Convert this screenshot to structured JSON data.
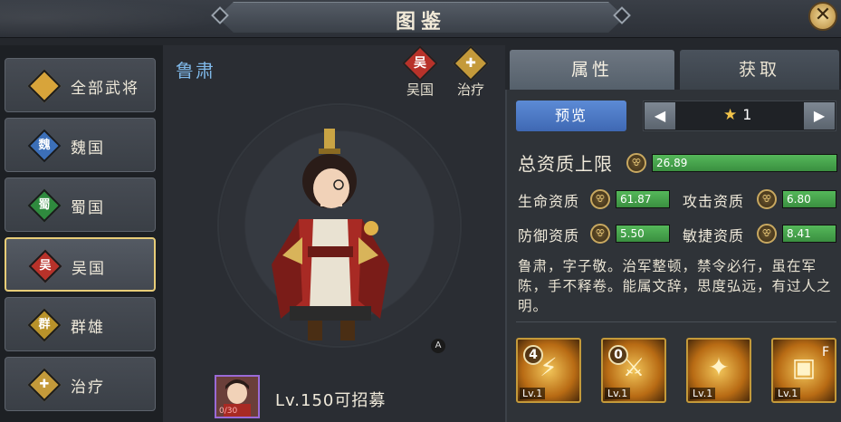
{
  "header": {
    "title": "图鉴",
    "close_symbol": "✕"
  },
  "sidebar": {
    "items": [
      {
        "label": "全部武将",
        "icon": "all-generals-icon",
        "glyph": "",
        "color": "#d8a43a",
        "active": false
      },
      {
        "label": "魏国",
        "icon": "wei-icon",
        "glyph": "魏",
        "color": "#3c6fb8",
        "active": false
      },
      {
        "label": "蜀国",
        "icon": "shu-icon",
        "glyph": "蜀",
        "color": "#2f8a3e",
        "active": false
      },
      {
        "label": "吴国",
        "icon": "wu-icon",
        "glyph": "吴",
        "color": "#b8322a",
        "active": true
      },
      {
        "label": "群雄",
        "icon": "qunxiong-icon",
        "glyph": "群",
        "color": "#b8922a",
        "active": false
      },
      {
        "label": "治疗",
        "icon": "heal-icon",
        "glyph": "✚",
        "color": "#c49a3a",
        "active": false
      }
    ]
  },
  "hero": {
    "name": "鲁肃",
    "faction": {
      "label": "吴国",
      "glyph": "吴"
    },
    "role": {
      "label": "治疗",
      "glyph": "✚"
    },
    "portrait_count": "0/30",
    "recruit_text": "Lv.150可招募",
    "badge": "A"
  },
  "tabs": {
    "attributes": "属性",
    "obtain": "获取"
  },
  "panel": {
    "preview_label": "预览",
    "star_value": "1",
    "total": {
      "label": "总资质上限",
      "value": "26.89",
      "fill": 1.0
    },
    "stats": [
      {
        "label": "生命资质",
        "value": "61.87",
        "fill": 1.0
      },
      {
        "label": "攻击资质",
        "value": "6.80",
        "fill": 1.0
      },
      {
        "label": "防御资质",
        "value": "5.50",
        "fill": 1.0
      },
      {
        "label": "敏捷资质",
        "value": "8.41",
        "fill": 1.0
      }
    ],
    "description": "鲁肃，字子敬。治军整顿，禁令必行，虽在军陈，手不释卷。能属文辞，思度弘远，有过人之明。",
    "skills": [
      {
        "level": "Lv.1",
        "count": "4",
        "mark": ""
      },
      {
        "level": "Lv.1",
        "count": "0",
        "mark": ""
      },
      {
        "level": "Lv.1",
        "count": "",
        "mark": ""
      },
      {
        "level": "Lv.1",
        "count": "",
        "mark": "F"
      }
    ]
  }
}
